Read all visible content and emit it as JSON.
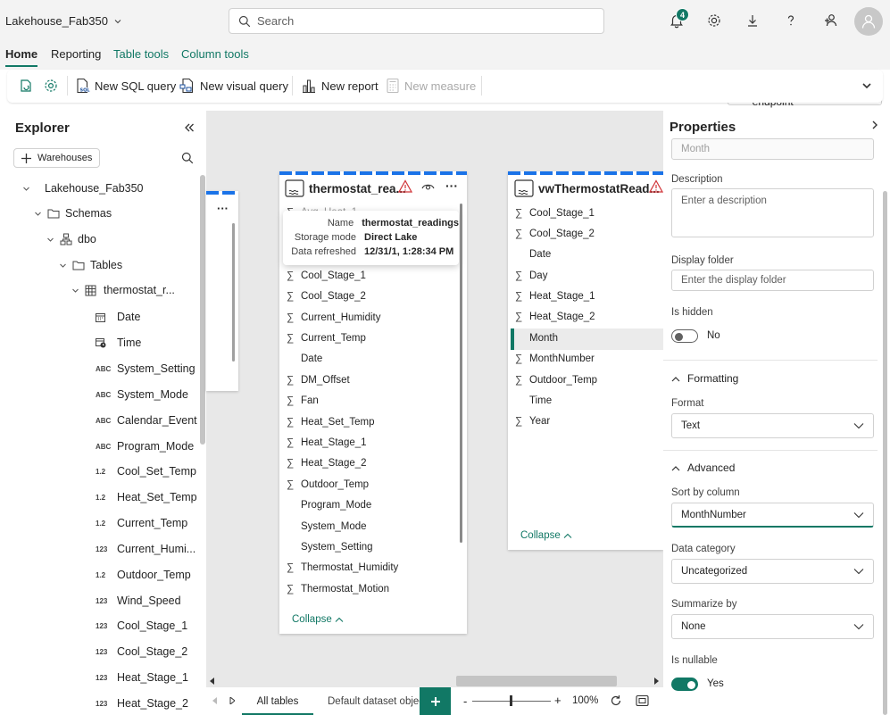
{
  "topbar": {
    "workspace_name": "Lakehouse_Fab350",
    "search_placeholder": "Search",
    "notification_count": "4"
  },
  "ribbon_tabs": [
    "Home",
    "Reporting",
    "Table tools",
    "Column tools"
  ],
  "endpoint_selector": "SQL analytics endpoint",
  "ribbon": {
    "new_sql_query": "New SQL query",
    "new_visual_query": "New visual query",
    "new_report": "New report",
    "new_measure": "New measure"
  },
  "explorer": {
    "title": "Explorer",
    "warehouses_button": "Warehouses",
    "tree": {
      "lakehouse": "Lakehouse_Fab350",
      "schemas": "Schemas",
      "dbo": "dbo",
      "tables": "Tables",
      "table": "thermostat_r..."
    },
    "columns": [
      {
        "type": "date",
        "name": "Date"
      },
      {
        "type": "time",
        "name": "Time"
      },
      {
        "type": "ABC",
        "name": "System_Setting"
      },
      {
        "type": "ABC",
        "name": "System_Mode"
      },
      {
        "type": "ABC",
        "name": "Calendar_Event"
      },
      {
        "type": "ABC",
        "name": "Program_Mode"
      },
      {
        "type": "1.2",
        "name": "Cool_Set_Temp"
      },
      {
        "type": "1.2",
        "name": "Heat_Set_Temp"
      },
      {
        "type": "1.2",
        "name": "Current_Temp"
      },
      {
        "type": "123",
        "name": "Current_Humi..."
      },
      {
        "type": "1.2",
        "name": "Outdoor_Temp"
      },
      {
        "type": "123",
        "name": "Wind_Speed"
      },
      {
        "type": "123",
        "name": "Cool_Stage_1"
      },
      {
        "type": "123",
        "name": "Cool_Stage_2"
      },
      {
        "type": "123",
        "name": "Heat_Stage_1"
      },
      {
        "type": "123",
        "name": "Heat_Stage_2"
      }
    ]
  },
  "card_thermostat": {
    "title": "thermostat_rea...",
    "hidden_first_field": "Avg_Heat_1",
    "tooltip": {
      "name_label": "Name",
      "name_value": "thermostat_readings",
      "storage_label": "Storage mode",
      "storage_value": "Direct Lake",
      "refreshed_label": "Data refreshed",
      "refreshed_value": "12/31/1, 1:28:34 PM"
    },
    "fields": [
      {
        "sigma": true,
        "name": "Cool_Stage_1"
      },
      {
        "sigma": true,
        "name": "Cool_Stage_2"
      },
      {
        "sigma": true,
        "name": "Current_Humidity"
      },
      {
        "sigma": true,
        "name": "Current_Temp"
      },
      {
        "sigma": false,
        "name": "Date"
      },
      {
        "sigma": true,
        "name": "DM_Offset"
      },
      {
        "sigma": true,
        "name": "Fan"
      },
      {
        "sigma": true,
        "name": "Heat_Set_Temp"
      },
      {
        "sigma": true,
        "name": "Heat_Stage_1"
      },
      {
        "sigma": true,
        "name": "Heat_Stage_2"
      },
      {
        "sigma": true,
        "name": "Outdoor_Temp"
      },
      {
        "sigma": false,
        "name": "Program_Mode"
      },
      {
        "sigma": false,
        "name": "System_Mode"
      },
      {
        "sigma": false,
        "name": "System_Setting"
      },
      {
        "sigma": true,
        "name": "Thermostat_Humidity"
      },
      {
        "sigma": true,
        "name": "Thermostat_Motion"
      }
    ],
    "collapse": "Collapse"
  },
  "card_view": {
    "title": "vwThermostatRead...",
    "fields": [
      {
        "sigma": true,
        "name": "Cool_Stage_1"
      },
      {
        "sigma": true,
        "name": "Cool_Stage_2"
      },
      {
        "sigma": false,
        "name": "Date"
      },
      {
        "sigma": true,
        "name": "Day"
      },
      {
        "sigma": true,
        "name": "Heat_Stage_1"
      },
      {
        "sigma": true,
        "name": "Heat_Stage_2"
      },
      {
        "sigma": false,
        "name": "Month",
        "selected": true
      },
      {
        "sigma": true,
        "name": "MonthNumber"
      },
      {
        "sigma": true,
        "name": "Outdoor_Temp"
      },
      {
        "sigma": false,
        "name": "Time"
      },
      {
        "sigma": true,
        "name": "Year"
      }
    ],
    "collapse": "Collapse"
  },
  "bottom": {
    "tab_all_tables": "All tables",
    "tab_default": "Default dataset objec",
    "zoom": "100%"
  },
  "properties": {
    "title": "Properties",
    "name_value": "Month",
    "description_label": "Description",
    "description_placeholder": "Enter a description",
    "display_folder_label": "Display folder",
    "display_folder_placeholder": "Enter the display folder",
    "is_hidden_label": "Is hidden",
    "is_hidden_value": "No",
    "formatting_section": "Formatting",
    "format_label": "Format",
    "format_value": "Text",
    "advanced_section": "Advanced",
    "sort_by_label": "Sort by column",
    "sort_by_value": "MonthNumber",
    "data_category_label": "Data category",
    "data_category_value": "Uncategorized",
    "summarize_label": "Summarize by",
    "summarize_value": "None",
    "nullable_label": "Is nullable",
    "nullable_value": "Yes"
  },
  "colors": {
    "accent": "#117865",
    "card_stripe": "#1a73e8",
    "warning": "#d13438"
  }
}
